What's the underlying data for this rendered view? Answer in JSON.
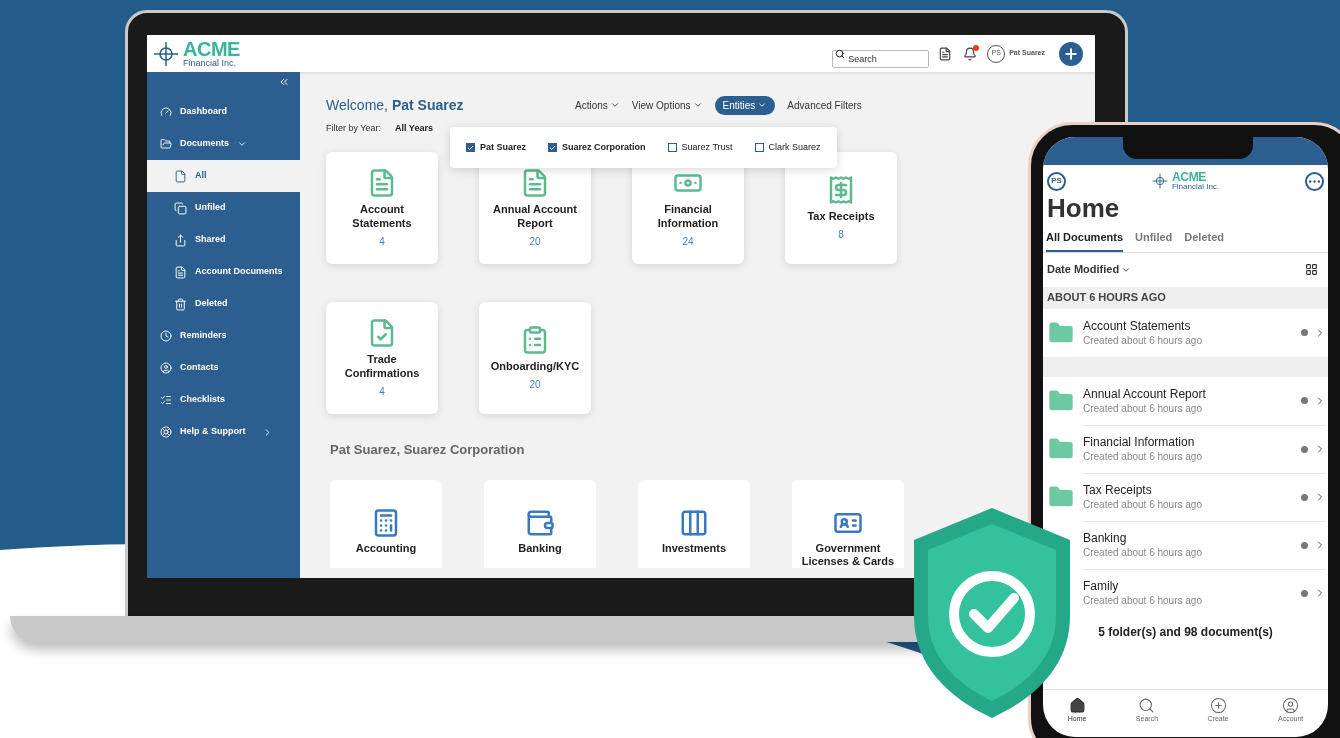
{
  "laptop": {
    "logo": {
      "name": "ACME",
      "tagline": "Financial Inc."
    },
    "search": {
      "placeholder": "Search"
    },
    "user": {
      "initials": "PS",
      "name": "Pat Suarez"
    },
    "sidebar": {
      "items": [
        {
          "label": "Dashboard",
          "selected": false
        },
        {
          "label": "Documents",
          "selected": false,
          "expanded": true,
          "children": [
            {
              "label": "All",
              "selected": true
            },
            {
              "label": "Unfiled",
              "selected": false
            },
            {
              "label": "Shared",
              "selected": false
            },
            {
              "label": "Account Documents",
              "selected": false
            },
            {
              "label": "Deleted",
              "selected": false
            }
          ]
        },
        {
          "label": "Reminders",
          "selected": false
        },
        {
          "label": "Contacts",
          "selected": false
        },
        {
          "label": "Checklists",
          "selected": false
        },
        {
          "label": "Help & Support",
          "selected": false,
          "expanded": false
        }
      ]
    },
    "welcome": {
      "greeting": "Welcome,",
      "name": "Pat Suarez"
    },
    "toolbar": [
      {
        "label": "Actions",
        "kind": "dropdown",
        "selected": false
      },
      {
        "label": "View Options",
        "kind": "dropdown",
        "selected": false
      },
      {
        "label": "Entities",
        "kind": "dropdown",
        "selected": true
      },
      {
        "label": "Advanced Filters",
        "kind": "link",
        "selected": false
      }
    ],
    "filter": {
      "label": "Filter by Year:",
      "value": "All Years"
    },
    "entities_menu": [
      {
        "label": "Pat Suarez",
        "checked": true
      },
      {
        "label": "Suarez Corporation",
        "checked": true
      },
      {
        "label": "Suarez Trust",
        "checked": false
      },
      {
        "label": "Clark Suarez",
        "checked": false
      }
    ],
    "categories": [
      {
        "title": "Account Statements",
        "count": "4"
      },
      {
        "title": "Annual Account Report",
        "count": "20"
      },
      {
        "title": "Financial Information",
        "count": "24"
      },
      {
        "title": "Tax Receipts",
        "count": "8"
      },
      {
        "title": "Trade Confirmations",
        "count": "4"
      },
      {
        "title": "Onboarding/KYC",
        "count": "20"
      }
    ],
    "section": {
      "title": "Pat Suarez, Suarez Corporation",
      "categories": [
        {
          "title": "Accounting"
        },
        {
          "title": "Banking"
        },
        {
          "title": "Investments"
        },
        {
          "title": "Government Licenses & Cards"
        }
      ]
    }
  },
  "phone": {
    "user_initials": "PS",
    "logo": {
      "name": "ACME",
      "tagline": "Financial Inc."
    },
    "title": "Home",
    "tabs": [
      {
        "label": "All Documents",
        "selected": true
      },
      {
        "label": "Unfiled",
        "selected": false
      },
      {
        "label": "Deleted",
        "selected": false
      }
    ],
    "sort": "Date Modified",
    "group": "ABOUT 6 HOURS AGO",
    "folders": [
      {
        "name": "Account Statements",
        "subtitle": "Created about 6 hours ago"
      },
      {
        "name": "Annual Account Report",
        "subtitle": "Created about 6 hours ago"
      },
      {
        "name": "Financial Information",
        "subtitle": "Created about 6 hours ago"
      },
      {
        "name": "Tax Receipts",
        "subtitle": "Created about 6 hours ago"
      },
      {
        "name": "Banking",
        "subtitle": "Created about 6 hours ago"
      },
      {
        "name": "Family",
        "subtitle": "Created about 6 hours ago"
      }
    ],
    "summary": "5 folder(s) and 98 document(s)",
    "nav": [
      {
        "label": "Home",
        "selected": true
      },
      {
        "label": "Search",
        "selected": false
      },
      {
        "label": "Create",
        "selected": false
      },
      {
        "label": "Account",
        "selected": false
      }
    ]
  }
}
